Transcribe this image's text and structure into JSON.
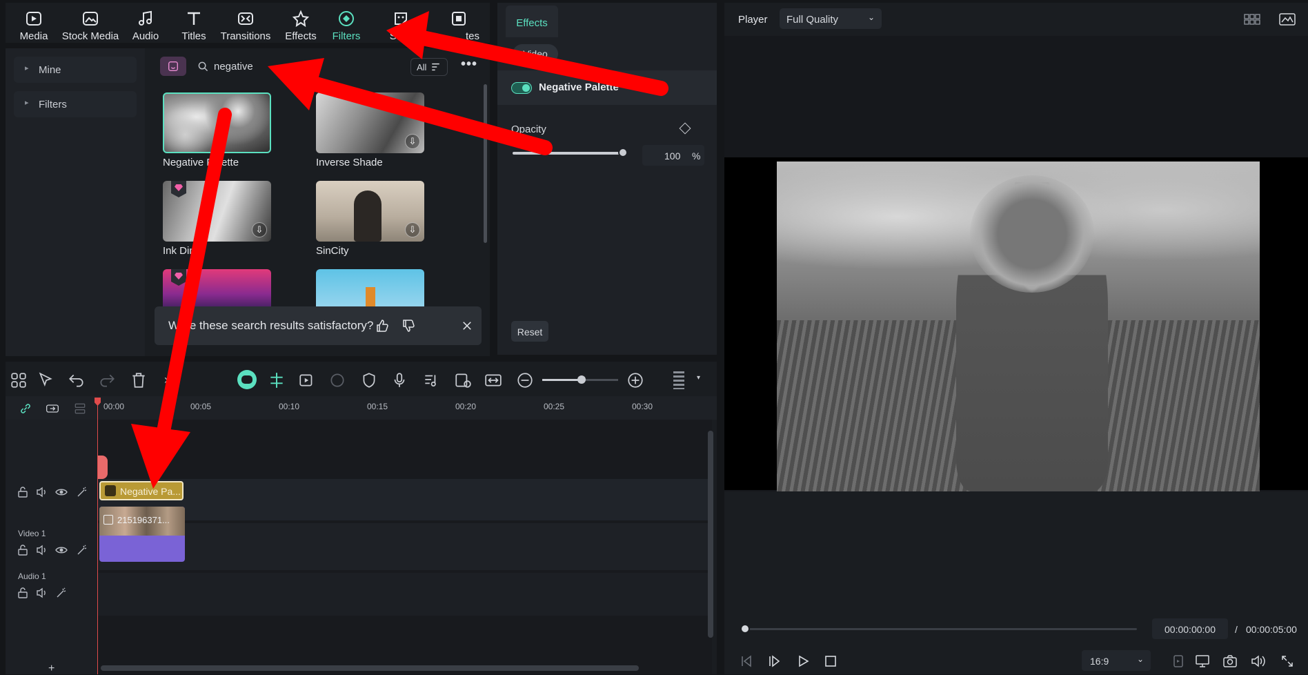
{
  "toolbar": {
    "tabs": [
      {
        "label": "Media",
        "icon": "media-icon"
      },
      {
        "label": "Stock Media",
        "icon": "stock-media-icon"
      },
      {
        "label": "Audio",
        "icon": "audio-icon"
      },
      {
        "label": "Titles",
        "icon": "titles-icon"
      },
      {
        "label": "Transitions",
        "icon": "transitions-icon"
      },
      {
        "label": "Effects",
        "icon": "effects-icon"
      },
      {
        "label": "Filters",
        "icon": "filters-icon",
        "active": true
      },
      {
        "label": "Stick",
        "icon": "stickers-icon"
      },
      {
        "label": "tes",
        "icon": "templates-icon"
      }
    ]
  },
  "sidebar": {
    "items": [
      {
        "label": "Mine"
      },
      {
        "label": "Filters"
      }
    ]
  },
  "search": {
    "value": "negative",
    "filter_label": "All"
  },
  "results": [
    {
      "label": "Negative Palette",
      "selected": true
    },
    {
      "label": "Inverse Shade"
    },
    {
      "label": "Ink Dim"
    },
    {
      "label": "SinCity"
    },
    {
      "label": ""
    },
    {
      "label": ""
    }
  ],
  "feedback": {
    "text": "Were these search results satisfactory?"
  },
  "effects_panel": {
    "tab": "Effects",
    "subtab": "Video",
    "effect_name": "Negative Palette",
    "opacity_label": "Opacity",
    "opacity_value": "100",
    "opacity_unit": "%",
    "opacity_level": 1.0,
    "reset_label": "Reset"
  },
  "player": {
    "label": "Player",
    "quality": "Full Quality",
    "current_time": "00:00:00:00",
    "separator": "/",
    "total_time": "00:00:05:00",
    "aspect": "16:9",
    "progress": 0
  },
  "timeline": {
    "ruler": [
      "00:00",
      "00:05",
      "00:10",
      "00:15",
      "00:20",
      "00:25",
      "00:30"
    ],
    "tracks": [
      {
        "label": ""
      },
      {
        "label": "Video 1"
      },
      {
        "label": "Audio 1"
      }
    ],
    "filter_clip": "Negative Pa...",
    "video_clip": "215196371...",
    "add_track": "+"
  },
  "colors": {
    "accent": "#5be0c0",
    "arrow": "#ff0000",
    "clip_gold": "#b99a35",
    "clip_purple": "#7a63d6"
  }
}
